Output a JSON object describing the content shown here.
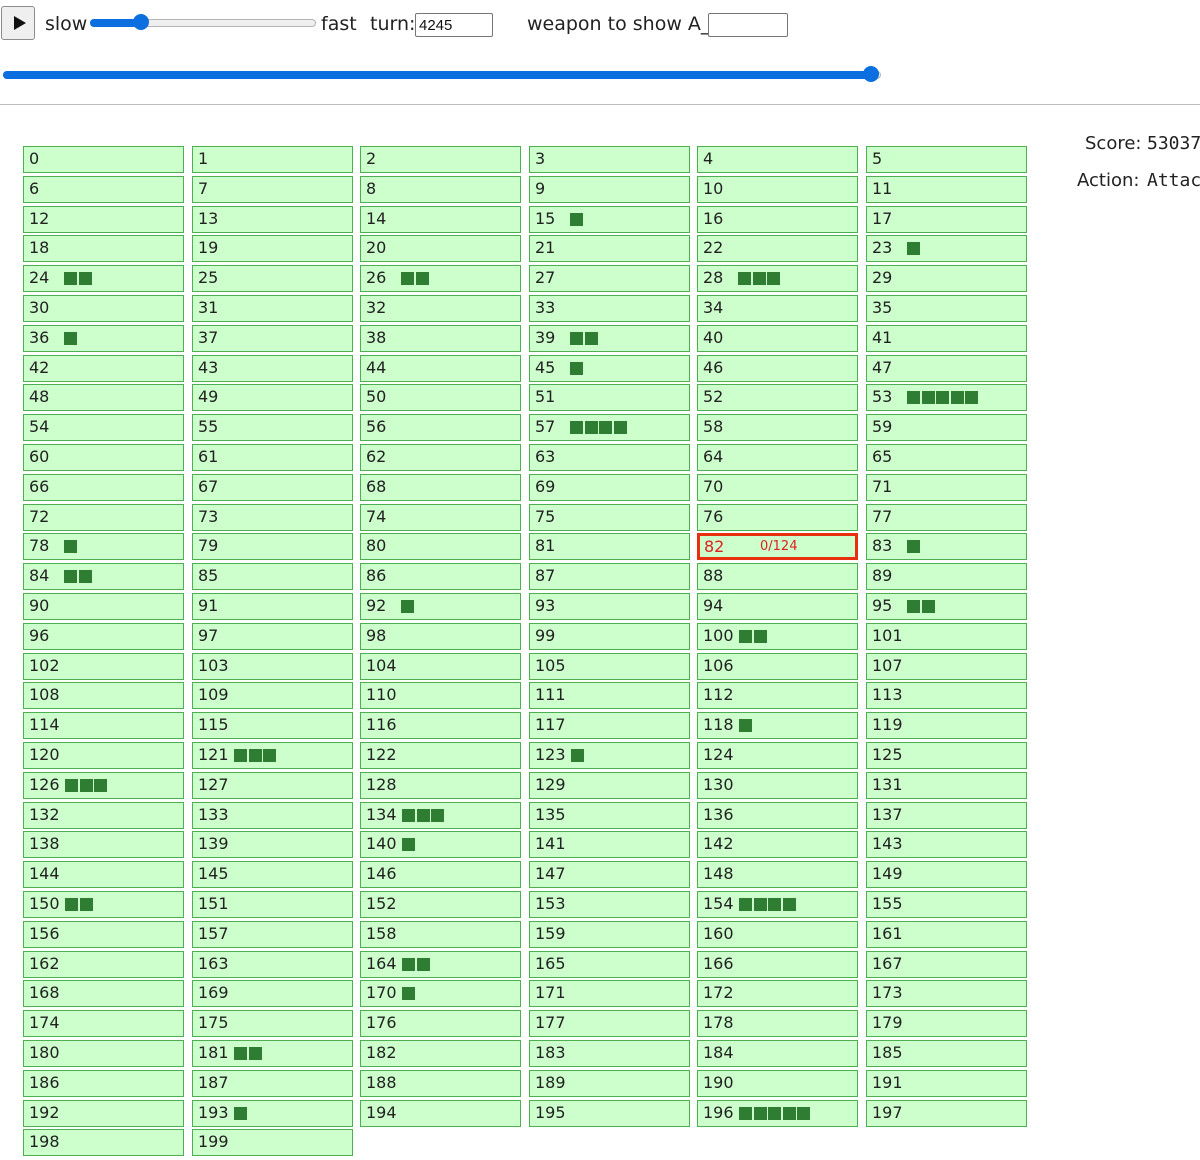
{
  "controls": {
    "play_icon": "play-icon",
    "slow_label": "slow",
    "fast_label": "fast",
    "speed_level": 0.22,
    "turn_label": "turn:",
    "turn_value": "4245",
    "weapon_label": "weapon to show A_ij:",
    "weapon_value": "",
    "turn_progress": 1.0
  },
  "grid": {
    "cells": [
      {
        "index": "0",
        "blocks": 0
      },
      {
        "index": "1",
        "blocks": 0
      },
      {
        "index": "2",
        "blocks": 0
      },
      {
        "index": "3",
        "blocks": 0
      },
      {
        "index": "4",
        "blocks": 0
      },
      {
        "index": "5",
        "blocks": 0
      },
      {
        "index": "6",
        "blocks": 0
      },
      {
        "index": "7",
        "blocks": 0
      },
      {
        "index": "8",
        "blocks": 0
      },
      {
        "index": "9",
        "blocks": 0
      },
      {
        "index": "10",
        "blocks": 0
      },
      {
        "index": "11",
        "blocks": 0
      },
      {
        "index": "12",
        "blocks": 0
      },
      {
        "index": "13",
        "blocks": 0
      },
      {
        "index": "14",
        "blocks": 0
      },
      {
        "index": "15",
        "blocks": 1
      },
      {
        "index": "16",
        "blocks": 0
      },
      {
        "index": "17",
        "blocks": 0
      },
      {
        "index": "18",
        "blocks": 0
      },
      {
        "index": "19",
        "blocks": 0
      },
      {
        "index": "20",
        "blocks": 0
      },
      {
        "index": "21",
        "blocks": 0
      },
      {
        "index": "22",
        "blocks": 0
      },
      {
        "index": "23",
        "blocks": 1
      },
      {
        "index": "24",
        "blocks": 2
      },
      {
        "index": "25",
        "blocks": 0
      },
      {
        "index": "26",
        "blocks": 2
      },
      {
        "index": "27",
        "blocks": 0
      },
      {
        "index": "28",
        "blocks": 3
      },
      {
        "index": "29",
        "blocks": 0
      },
      {
        "index": "30",
        "blocks": 0
      },
      {
        "index": "31",
        "blocks": 0
      },
      {
        "index": "32",
        "blocks": 0
      },
      {
        "index": "33",
        "blocks": 0
      },
      {
        "index": "34",
        "blocks": 0
      },
      {
        "index": "35",
        "blocks": 0
      },
      {
        "index": "36",
        "blocks": 1
      },
      {
        "index": "37",
        "blocks": 0
      },
      {
        "index": "38",
        "blocks": 0
      },
      {
        "index": "39",
        "blocks": 2
      },
      {
        "index": "40",
        "blocks": 0
      },
      {
        "index": "41",
        "blocks": 0
      },
      {
        "index": "42",
        "blocks": 0
      },
      {
        "index": "43",
        "blocks": 0
      },
      {
        "index": "44",
        "blocks": 0
      },
      {
        "index": "45",
        "blocks": 1
      },
      {
        "index": "46",
        "blocks": 0
      },
      {
        "index": "47",
        "blocks": 0
      },
      {
        "index": "48",
        "blocks": 0
      },
      {
        "index": "49",
        "blocks": 0
      },
      {
        "index": "50",
        "blocks": 0
      },
      {
        "index": "51",
        "blocks": 0
      },
      {
        "index": "52",
        "blocks": 0
      },
      {
        "index": "53",
        "blocks": 5
      },
      {
        "index": "54",
        "blocks": 0
      },
      {
        "index": "55",
        "blocks": 0
      },
      {
        "index": "56",
        "blocks": 0
      },
      {
        "index": "57",
        "blocks": 4
      },
      {
        "index": "58",
        "blocks": 0
      },
      {
        "index": "59",
        "blocks": 0
      },
      {
        "index": "60",
        "blocks": 0
      },
      {
        "index": "61",
        "blocks": 0
      },
      {
        "index": "62",
        "blocks": 0
      },
      {
        "index": "63",
        "blocks": 0
      },
      {
        "index": "64",
        "blocks": 0
      },
      {
        "index": "65",
        "blocks": 0
      },
      {
        "index": "66",
        "blocks": 0
      },
      {
        "index": "67",
        "blocks": 0
      },
      {
        "index": "68",
        "blocks": 0
      },
      {
        "index": "69",
        "blocks": 0
      },
      {
        "index": "70",
        "blocks": 0
      },
      {
        "index": "71",
        "blocks": 0
      },
      {
        "index": "72",
        "blocks": 0
      },
      {
        "index": "73",
        "blocks": 0
      },
      {
        "index": "74",
        "blocks": 0
      },
      {
        "index": "75",
        "blocks": 0
      },
      {
        "index": "76",
        "blocks": 0
      },
      {
        "index": "77",
        "blocks": 0
      },
      {
        "index": "78",
        "blocks": 1
      },
      {
        "index": "79",
        "blocks": 0
      },
      {
        "index": "80",
        "blocks": 0
      },
      {
        "index": "81",
        "blocks": 0
      },
      {
        "index": "82",
        "blocks": 0,
        "selected": true,
        "count": "0/124"
      },
      {
        "index": "83",
        "blocks": 1
      },
      {
        "index": "84",
        "blocks": 2
      },
      {
        "index": "85",
        "blocks": 0
      },
      {
        "index": "86",
        "blocks": 0
      },
      {
        "index": "87",
        "blocks": 0
      },
      {
        "index": "88",
        "blocks": 0
      },
      {
        "index": "89",
        "blocks": 0
      },
      {
        "index": "90",
        "blocks": 0
      },
      {
        "index": "91",
        "blocks": 0
      },
      {
        "index": "92",
        "blocks": 1
      },
      {
        "index": "93",
        "blocks": 0
      },
      {
        "index": "94",
        "blocks": 0
      },
      {
        "index": "95",
        "blocks": 2
      },
      {
        "index": "96",
        "blocks": 0
      },
      {
        "index": "97",
        "blocks": 0
      },
      {
        "index": "98",
        "blocks": 0
      },
      {
        "index": "99",
        "blocks": 0
      },
      {
        "index": "100",
        "blocks": 2
      },
      {
        "index": "101",
        "blocks": 0
      },
      {
        "index": "102",
        "blocks": 0
      },
      {
        "index": "103",
        "blocks": 0
      },
      {
        "index": "104",
        "blocks": 0
      },
      {
        "index": "105",
        "blocks": 0
      },
      {
        "index": "106",
        "blocks": 0
      },
      {
        "index": "107",
        "blocks": 0
      },
      {
        "index": "108",
        "blocks": 0
      },
      {
        "index": "109",
        "blocks": 0
      },
      {
        "index": "110",
        "blocks": 0
      },
      {
        "index": "111",
        "blocks": 0
      },
      {
        "index": "112",
        "blocks": 0
      },
      {
        "index": "113",
        "blocks": 0
      },
      {
        "index": "114",
        "blocks": 0
      },
      {
        "index": "115",
        "blocks": 0
      },
      {
        "index": "116",
        "blocks": 0
      },
      {
        "index": "117",
        "blocks": 0
      },
      {
        "index": "118",
        "blocks": 1
      },
      {
        "index": "119",
        "blocks": 0
      },
      {
        "index": "120",
        "blocks": 0
      },
      {
        "index": "121",
        "blocks": 3
      },
      {
        "index": "122",
        "blocks": 0
      },
      {
        "index": "123",
        "blocks": 1
      },
      {
        "index": "124",
        "blocks": 0
      },
      {
        "index": "125",
        "blocks": 0
      },
      {
        "index": "126",
        "blocks": 3
      },
      {
        "index": "127",
        "blocks": 0
      },
      {
        "index": "128",
        "blocks": 0
      },
      {
        "index": "129",
        "blocks": 0
      },
      {
        "index": "130",
        "blocks": 0
      },
      {
        "index": "131",
        "blocks": 0
      },
      {
        "index": "132",
        "blocks": 0
      },
      {
        "index": "133",
        "blocks": 0
      },
      {
        "index": "134",
        "blocks": 3
      },
      {
        "index": "135",
        "blocks": 0
      },
      {
        "index": "136",
        "blocks": 0
      },
      {
        "index": "137",
        "blocks": 0
      },
      {
        "index": "138",
        "blocks": 0
      },
      {
        "index": "139",
        "blocks": 0
      },
      {
        "index": "140",
        "blocks": 1
      },
      {
        "index": "141",
        "blocks": 0
      },
      {
        "index": "142",
        "blocks": 0
      },
      {
        "index": "143",
        "blocks": 0
      },
      {
        "index": "144",
        "blocks": 0
      },
      {
        "index": "145",
        "blocks": 0
      },
      {
        "index": "146",
        "blocks": 0
      },
      {
        "index": "147",
        "blocks": 0
      },
      {
        "index": "148",
        "blocks": 0
      },
      {
        "index": "149",
        "blocks": 0
      },
      {
        "index": "150",
        "blocks": 2
      },
      {
        "index": "151",
        "blocks": 0
      },
      {
        "index": "152",
        "blocks": 0
      },
      {
        "index": "153",
        "blocks": 0
      },
      {
        "index": "154",
        "blocks": 4
      },
      {
        "index": "155",
        "blocks": 0
      },
      {
        "index": "156",
        "blocks": 0
      },
      {
        "index": "157",
        "blocks": 0
      },
      {
        "index": "158",
        "blocks": 0
      },
      {
        "index": "159",
        "blocks": 0
      },
      {
        "index": "160",
        "blocks": 0
      },
      {
        "index": "161",
        "blocks": 0
      },
      {
        "index": "162",
        "blocks": 0
      },
      {
        "index": "163",
        "blocks": 0
      },
      {
        "index": "164",
        "blocks": 2
      },
      {
        "index": "165",
        "blocks": 0
      },
      {
        "index": "166",
        "blocks": 0
      },
      {
        "index": "167",
        "blocks": 0
      },
      {
        "index": "168",
        "blocks": 0
      },
      {
        "index": "169",
        "blocks": 0
      },
      {
        "index": "170",
        "blocks": 1
      },
      {
        "index": "171",
        "blocks": 0
      },
      {
        "index": "172",
        "blocks": 0
      },
      {
        "index": "173",
        "blocks": 0
      },
      {
        "index": "174",
        "blocks": 0
      },
      {
        "index": "175",
        "blocks": 0
      },
      {
        "index": "176",
        "blocks": 0
      },
      {
        "index": "177",
        "blocks": 0
      },
      {
        "index": "178",
        "blocks": 0
      },
      {
        "index": "179",
        "blocks": 0
      },
      {
        "index": "180",
        "blocks": 0
      },
      {
        "index": "181",
        "blocks": 2
      },
      {
        "index": "182",
        "blocks": 0
      },
      {
        "index": "183",
        "blocks": 0
      },
      {
        "index": "184",
        "blocks": 0
      },
      {
        "index": "185",
        "blocks": 0
      },
      {
        "index": "186",
        "blocks": 0
      },
      {
        "index": "187",
        "blocks": 0
      },
      {
        "index": "188",
        "blocks": 0
      },
      {
        "index": "189",
        "blocks": 0
      },
      {
        "index": "190",
        "blocks": 0
      },
      {
        "index": "191",
        "blocks": 0
      },
      {
        "index": "192",
        "blocks": 0
      },
      {
        "index": "193",
        "blocks": 1
      },
      {
        "index": "194",
        "blocks": 0
      },
      {
        "index": "195",
        "blocks": 0
      },
      {
        "index": "196",
        "blocks": 5
      },
      {
        "index": "197",
        "blocks": 0
      },
      {
        "index": "198",
        "blocks": 0
      },
      {
        "index": "199",
        "blocks": 0
      }
    ]
  },
  "info": {
    "score_label": "Score:",
    "score_value": "53037",
    "action_label": "Action:",
    "action_value": "Attack"
  },
  "colors": {
    "cell_fill": "#ccffcc",
    "cell_border": "#4caf50",
    "block": "#2e7d32",
    "selected_border": "#e8300e",
    "selected_text": "#e02020",
    "slider_accent": "#0b6fe0"
  }
}
